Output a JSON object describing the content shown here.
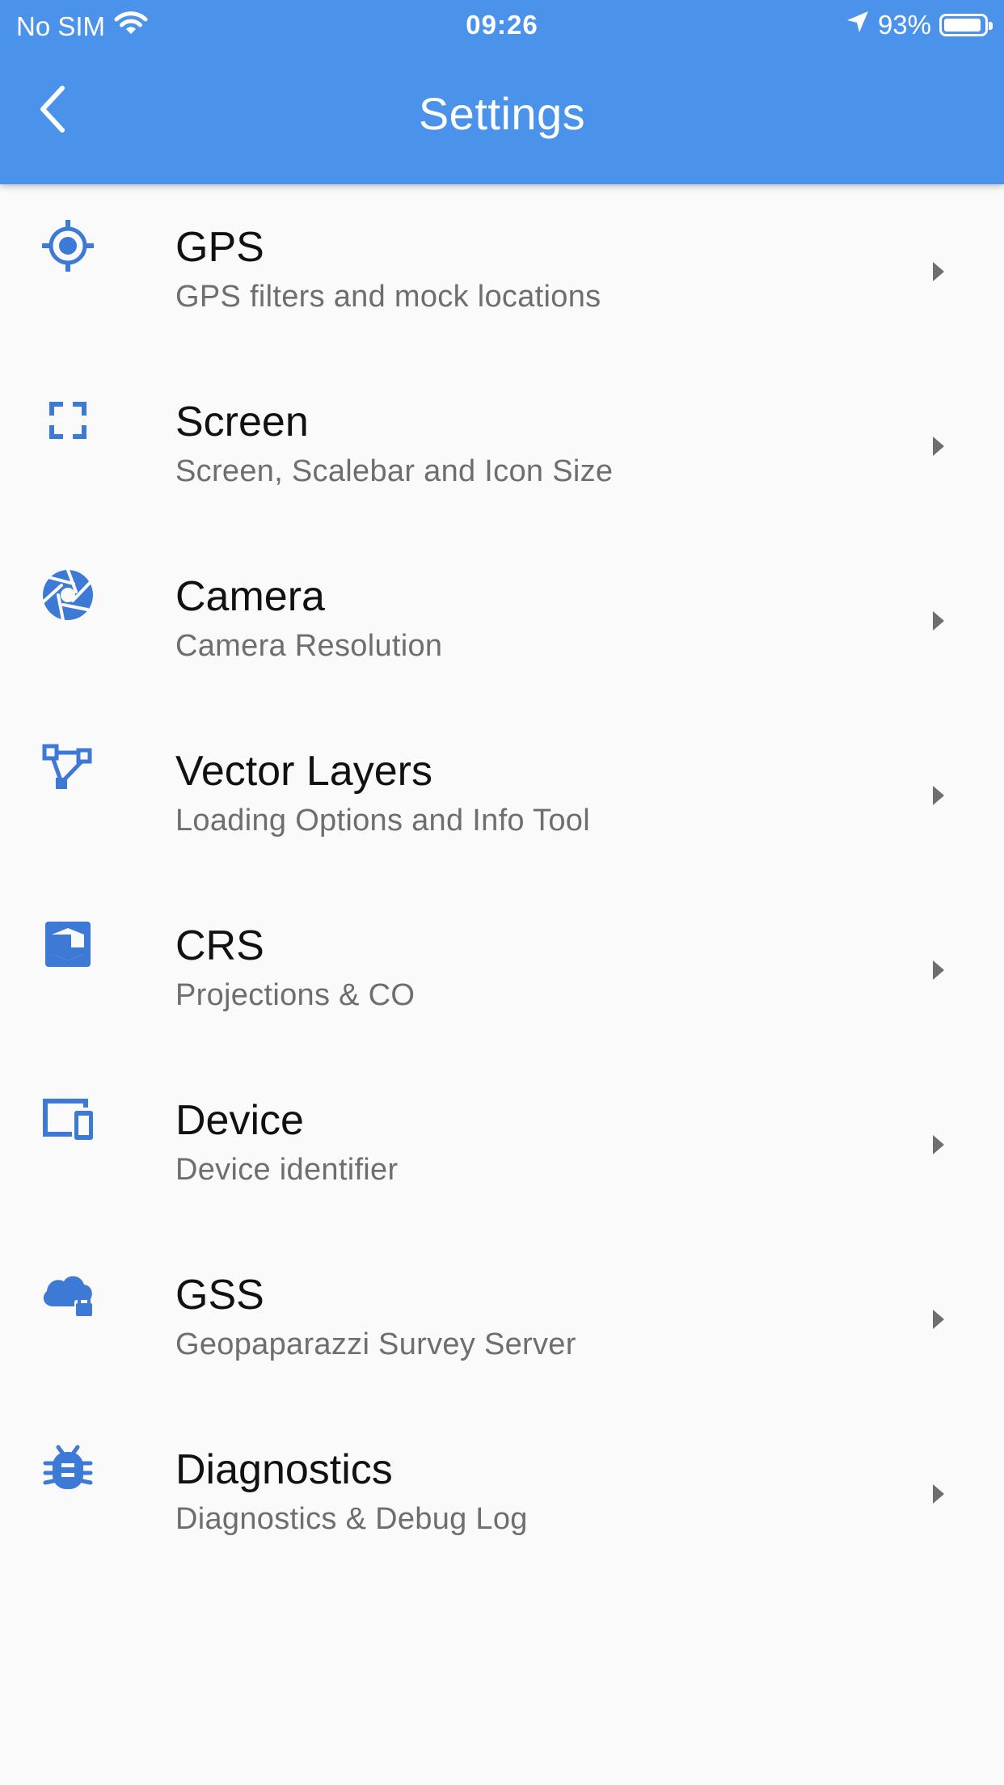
{
  "status_bar": {
    "carrier": "No SIM",
    "time": "09:26",
    "battery_percent": "93%",
    "battery_level": 0.93
  },
  "header": {
    "title": "Settings",
    "back_icon": "chevron-left-icon"
  },
  "colors": {
    "header_bg": "#4a92ea",
    "icon": "#3d7ad6",
    "title_text": "#111111",
    "subtitle_text": "#6e6e6e",
    "chevron": "#6f6f6f",
    "background": "#fafafa"
  },
  "settings": [
    {
      "key": "gps",
      "icon": "gps-target-icon",
      "title": "GPS",
      "subtitle": "GPS filters and mock locations"
    },
    {
      "key": "screen",
      "icon": "fullscreen-icon",
      "title": "Screen",
      "subtitle": "Screen, Scalebar and Icon Size"
    },
    {
      "key": "camera",
      "icon": "camera-shutter-icon",
      "title": "Camera",
      "subtitle": "Camera Resolution"
    },
    {
      "key": "vector-layers",
      "icon": "vector-polyline-icon",
      "title": "Vector Layers",
      "subtitle": "Loading Options and Info Tool"
    },
    {
      "key": "crs",
      "icon": "projection-icon",
      "title": "CRS",
      "subtitle": "Projections & CO"
    },
    {
      "key": "device",
      "icon": "devices-icon",
      "title": "Device",
      "subtitle": "Device identifier"
    },
    {
      "key": "gss",
      "icon": "cloud-lock-icon",
      "title": "GSS",
      "subtitle": "Geopaparazzi Survey Server"
    },
    {
      "key": "diagnostics",
      "icon": "bug-icon",
      "title": "Diagnostics",
      "subtitle": "Diagnostics & Debug Log"
    }
  ]
}
